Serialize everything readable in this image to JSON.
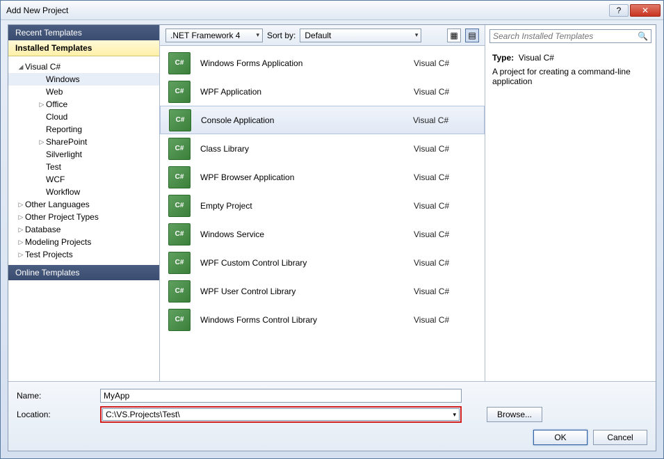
{
  "window": {
    "title": "Add New Project"
  },
  "sidebar": {
    "recent": "Recent Templates",
    "installed": "Installed Templates",
    "online": "Online Templates",
    "csharp": "Visual C#",
    "csharp_children": [
      "Windows",
      "Web",
      "Office",
      "Cloud",
      "Reporting",
      "SharePoint",
      "Silverlight",
      "Test",
      "WCF",
      "Workflow"
    ],
    "others": [
      "Other Languages",
      "Other Project Types",
      "Database",
      "Modeling Projects",
      "Test Projects"
    ]
  },
  "toolbar": {
    "framework": ".NET Framework 4",
    "sortby_label": "Sort by:",
    "sortby": "Default"
  },
  "templates": [
    {
      "name": "Windows Forms Application",
      "lang": "Visual C#"
    },
    {
      "name": "WPF Application",
      "lang": "Visual C#"
    },
    {
      "name": "Console Application",
      "lang": "Visual C#",
      "selected": true
    },
    {
      "name": "Class Library",
      "lang": "Visual C#"
    },
    {
      "name": "WPF Browser Application",
      "lang": "Visual C#"
    },
    {
      "name": "Empty Project",
      "lang": "Visual C#"
    },
    {
      "name": "Windows Service",
      "lang": "Visual C#"
    },
    {
      "name": "WPF Custom Control Library",
      "lang": "Visual C#"
    },
    {
      "name": "WPF User Control Library",
      "lang": "Visual C#"
    },
    {
      "name": "Windows Forms Control Library",
      "lang": "Visual C#"
    }
  ],
  "search": {
    "placeholder": "Search Installed Templates"
  },
  "detail": {
    "type_label": "Type:",
    "type_value": "Visual C#",
    "description": "A project for creating a command-line application"
  },
  "form": {
    "name_label": "Name:",
    "name_value": "MyApp",
    "location_label": "Location:",
    "location_value": "C:\\VS.Projects\\Test\\",
    "browse": "Browse..."
  },
  "buttons": {
    "ok": "OK",
    "cancel": "Cancel"
  }
}
